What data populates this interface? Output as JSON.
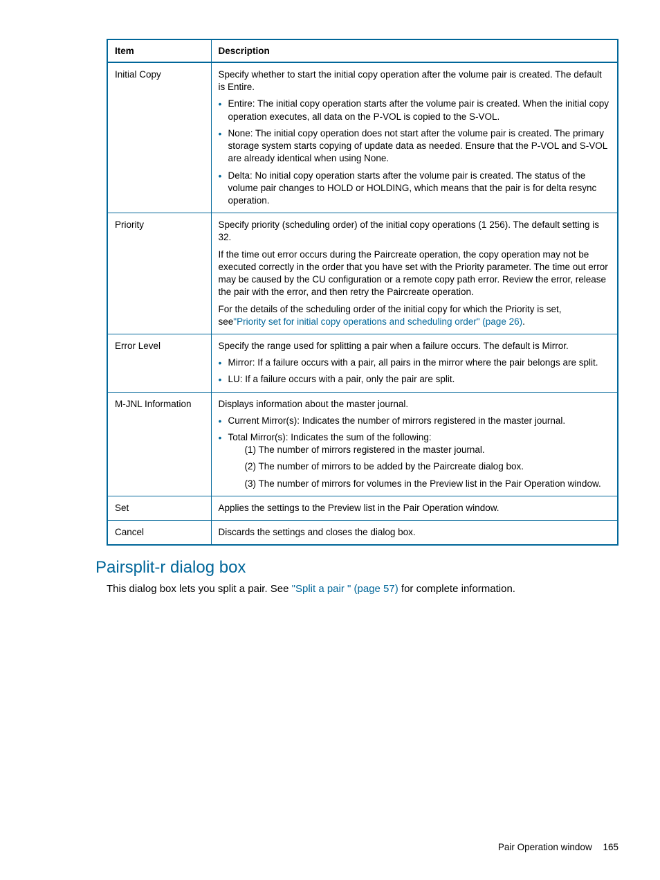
{
  "table": {
    "headers": {
      "item": "Item",
      "description": "Description"
    },
    "rows": {
      "initialCopy": {
        "item": "Initial Copy",
        "intro": "Specify whether to start the initial copy operation after the volume pair is created. The default is Entire.",
        "bullets": [
          "Entire: The initial copy operation starts after the volume pair is created. When the initial copy operation executes, all data on the P-VOL is copied to the S-VOL.",
          "None: The initial copy operation does not start after the volume pair is created. The primary storage system starts copying of update data as needed. Ensure that the P-VOL and S-VOL are already identical when using None.",
          "Delta: No initial copy operation starts after the volume pair is created. The status of the volume pair changes to HOLD or HOLDING, which means that the pair is for delta resync operation."
        ]
      },
      "priority": {
        "item": "Priority",
        "p1": "Specify priority (scheduling order) of the initial copy operations (1 256). The default setting is 32.",
        "p2": "If the time out error occurs during the Paircreate operation, the copy operation may not be executed correctly in the order that you have set with the Priority parameter. The time out error may be caused by the CU configuration or a remote copy path error. Review the error, release the pair with the error, and then retry the Paircreate operation.",
        "p3_prefix": "For the details of the scheduling order of the initial copy for which the Priority is set, see",
        "p3_link": "\"Priority set for initial copy operations and scheduling order\" (page 26)",
        "p3_suffix": "."
      },
      "errorLevel": {
        "item": "Error Level",
        "intro": "Specify the range used for splitting a pair when a failure occurs. The default is Mirror.",
        "bullets": [
          "Mirror: If a failure occurs with a pair, all pairs in the mirror where the pair belongs are split.",
          "LU: If a failure occurs with a pair, only the pair are split."
        ]
      },
      "mjnl": {
        "item": "M-JNL Information",
        "intro": "Displays information about the master journal.",
        "bullet1": "Current Mirror(s): Indicates the number of mirrors registered in the master journal.",
        "bullet2": "Total Mirror(s): Indicates the sum of the following:",
        "sub1": "(1) The number of mirrors registered in the master journal.",
        "sub2": "(2) The number of mirrors to be added by the Paircreate dialog box.",
        "sub3": "(3) The number of mirrors for volumes in the Preview list in the Pair Operation window."
      },
      "set": {
        "item": "Set",
        "desc": "Applies the settings to the Preview list in the Pair Operation window."
      },
      "cancel": {
        "item": "Cancel",
        "desc": "Discards the settings and closes the dialog box."
      }
    }
  },
  "heading": "Pairsplit-r dialog box",
  "bodyText": {
    "prefix": "This dialog box lets you split a pair. See ",
    "link": "\"Split a pair \" (page 57)",
    "suffix": " for complete information."
  },
  "footer": {
    "section": "Pair Operation window",
    "page": "165"
  }
}
